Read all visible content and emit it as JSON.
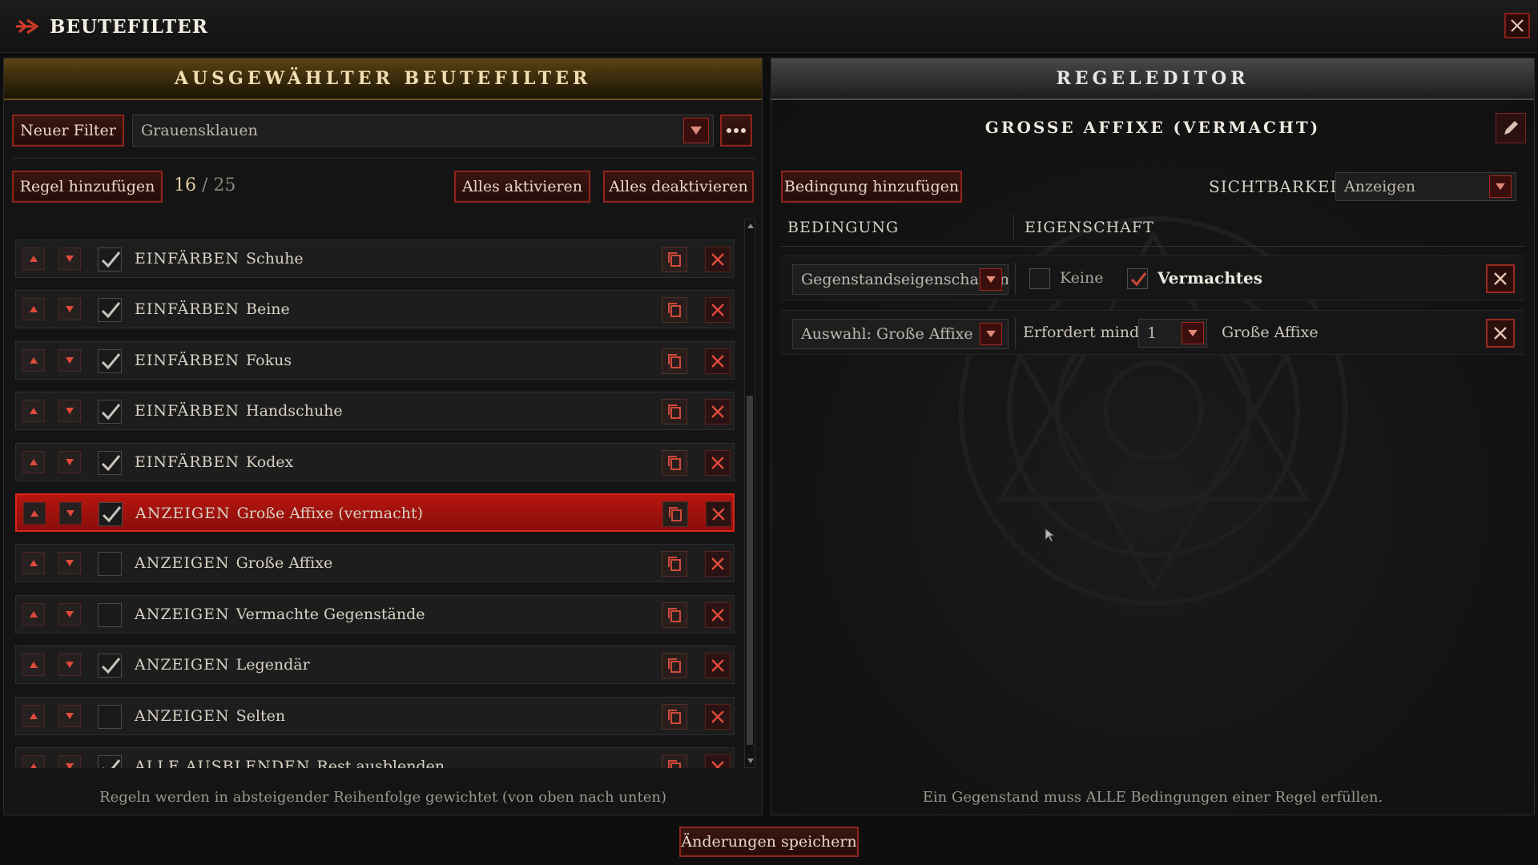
{
  "window": {
    "title": "BEUTEFILTER",
    "icons": {
      "title": "arrow-icon",
      "close": "close-icon"
    }
  },
  "left": {
    "header": "AUSGEWÄHLTER BEUTEFILTER",
    "new_filter_label": "Neuer Filter",
    "filter_name": "Grauensklauen",
    "add_rule_label": "Regel hinzufügen",
    "rule_count_current": "16",
    "rule_count_sep": "/",
    "rule_count_max": "25",
    "enable_all_label": "Alles aktivieren",
    "disable_all_label": "Alles deaktivieren",
    "rules": [
      {
        "type": "EINFÄRBEN",
        "name": "Schuhe",
        "checked": true,
        "selected": false
      },
      {
        "type": "EINFÄRBEN",
        "name": "Beine",
        "checked": true,
        "selected": false
      },
      {
        "type": "EINFÄRBEN",
        "name": "Fokus",
        "checked": true,
        "selected": false
      },
      {
        "type": "EINFÄRBEN",
        "name": "Handschuhe",
        "checked": true,
        "selected": false
      },
      {
        "type": "EINFÄRBEN",
        "name": "Kodex",
        "checked": true,
        "selected": false
      },
      {
        "type": "ANZEIGEN",
        "name": "Große Affixe (vermacht)",
        "checked": true,
        "selected": true
      },
      {
        "type": "ANZEIGEN",
        "name": "Große Affixe",
        "checked": false,
        "selected": false
      },
      {
        "type": "ANZEIGEN",
        "name": "Vermachte Gegenstände",
        "checked": false,
        "selected": false
      },
      {
        "type": "ANZEIGEN",
        "name": "Legendär",
        "checked": true,
        "selected": false
      },
      {
        "type": "ANZEIGEN",
        "name": "Selten",
        "checked": false,
        "selected": false
      },
      {
        "type": "ALLE AUSBLENDEN",
        "name": "Rest ausblenden",
        "checked": true,
        "selected": false
      }
    ],
    "footer": "Regeln werden in absteigender Reihenfolge gewichtet (von oben nach unten)"
  },
  "right": {
    "header": "REGELEDITOR",
    "rule_title": "GROSSE AFFIXE (VERMACHT)",
    "add_condition_label": "Bedingung hinzufügen",
    "visibility_label": "SICHTBARKEIT",
    "visibility_value": "Anzeigen",
    "col_condition": "BEDINGUNG",
    "col_property": "EIGENSCHAFT",
    "conditions": [
      {
        "select": "Gegenstandseigenschaften",
        "options": [
          {
            "label": "Keine",
            "checked": false
          },
          {
            "label": "Vermachtes",
            "checked": true
          }
        ]
      },
      {
        "select": "Auswahl: Große Affixe",
        "requires_label": "Erfordert mind.",
        "requires_value": "1",
        "suffix": "Große Affixe"
      }
    ],
    "footer": "Ein Gegenstand muss ALLE Bedingungen einer Regel erfüllen."
  },
  "save_label": "Änderungen speichern",
  "colors": {
    "accent_red": "#8e241c",
    "selected_row": "#b6150f",
    "gold_header": "#5a4316"
  }
}
